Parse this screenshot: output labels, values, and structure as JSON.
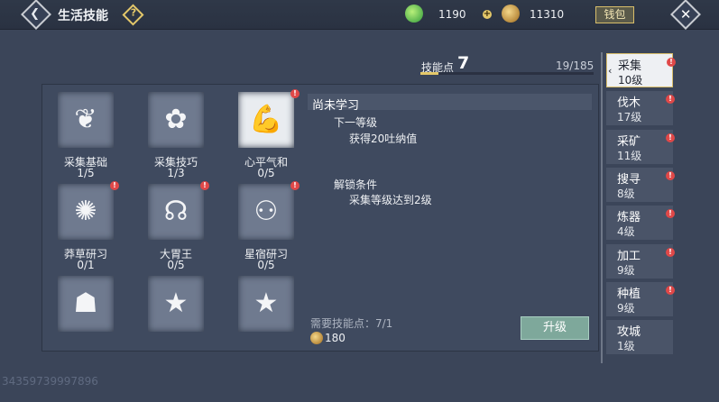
{
  "header": {
    "title": "生活技能",
    "help_label": "?",
    "currency1_value": "1190",
    "currency2_value": "11310",
    "wallet_label": "钱包"
  },
  "skill_points": {
    "label": "技能点",
    "value": "7",
    "count": "19/185",
    "progress": 0.103
  },
  "skills": [
    {
      "name": "采集基础",
      "level": "1/5",
      "icon": "wheat-icon",
      "selected": false,
      "alert": false
    },
    {
      "name": "采集技巧",
      "level": "1/3",
      "icon": "flower-icon",
      "selected": false,
      "alert": false
    },
    {
      "name": "心平气和",
      "level": "0/5",
      "icon": "flexed-arm-icon",
      "selected": true,
      "alert": true
    },
    {
      "name": "莽草研习",
      "level": "0/1",
      "icon": "herb-icon",
      "selected": false,
      "alert": true
    },
    {
      "name": "大胃王",
      "level": "0/5",
      "icon": "stomach-icon",
      "selected": false,
      "alert": true
    },
    {
      "name": "星宿研习",
      "level": "0/5",
      "icon": "constellation-icon",
      "selected": false,
      "alert": true
    },
    {
      "name": "",
      "level": "",
      "icon": "muscle-torso-icon",
      "selected": false,
      "alert": false
    },
    {
      "name": "",
      "level": "",
      "icon": "star-banner-icon",
      "selected": false,
      "alert": false
    },
    {
      "name": "",
      "level": "",
      "icon": "star-banner-icon",
      "selected": false,
      "alert": false
    }
  ],
  "detail": {
    "status": "尚未学习",
    "next_level_label": "下一等级",
    "next_level_text": "获得20吐纳值",
    "unlock_label": "解锁条件",
    "unlock_text": "采集等级达到2级",
    "need_text": "需要技能点：7/1",
    "cost_value": "180",
    "upgrade_label": "升级"
  },
  "categories": [
    {
      "name": "采集",
      "level": "10级",
      "active": true,
      "alert": true
    },
    {
      "name": "伐木",
      "level": "17级",
      "active": false,
      "alert": true
    },
    {
      "name": "采矿",
      "level": "11级",
      "active": false,
      "alert": true
    },
    {
      "name": "搜寻",
      "level": "8级",
      "active": false,
      "alert": true
    },
    {
      "name": "炼器",
      "level": "4级",
      "active": false,
      "alert": true
    },
    {
      "name": "加工",
      "level": "9级",
      "active": false,
      "alert": true
    },
    {
      "name": "种植",
      "level": "9级",
      "active": false,
      "alert": true
    },
    {
      "name": "攻城",
      "level": "1级",
      "active": false,
      "alert": false
    }
  ],
  "uid": "34359739997896",
  "colors": {
    "accent": "#e4c86a",
    "alert": "#e04848",
    "upgrade": "#7ea89b"
  }
}
